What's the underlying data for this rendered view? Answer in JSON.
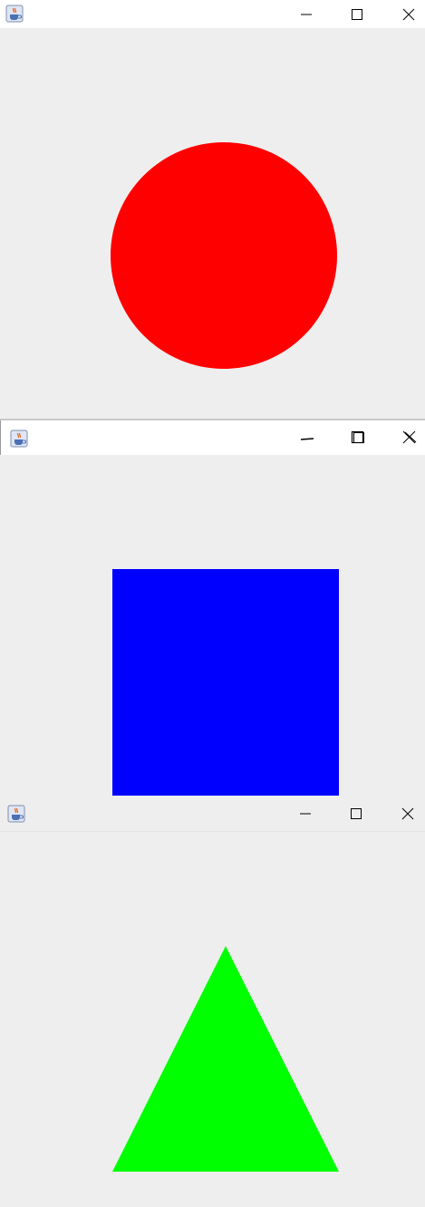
{
  "windows": [
    {
      "title": "",
      "shape": "circle",
      "color": "#ff0000",
      "controls": [
        "minimize-icon",
        "maximize-icon",
        "close-icon"
      ]
    },
    {
      "title": "",
      "shape": "square",
      "color": "#0000ff",
      "controls": [
        "minimize-icon",
        "maximize-icon",
        "close-icon"
      ]
    },
    {
      "title": "",
      "shape": "triangle",
      "color": "#00ff00",
      "controls": [
        "minimize-icon",
        "maximize-icon",
        "close-icon"
      ]
    }
  ],
  "icons": {
    "app": "java-coffee-cup-icon"
  }
}
